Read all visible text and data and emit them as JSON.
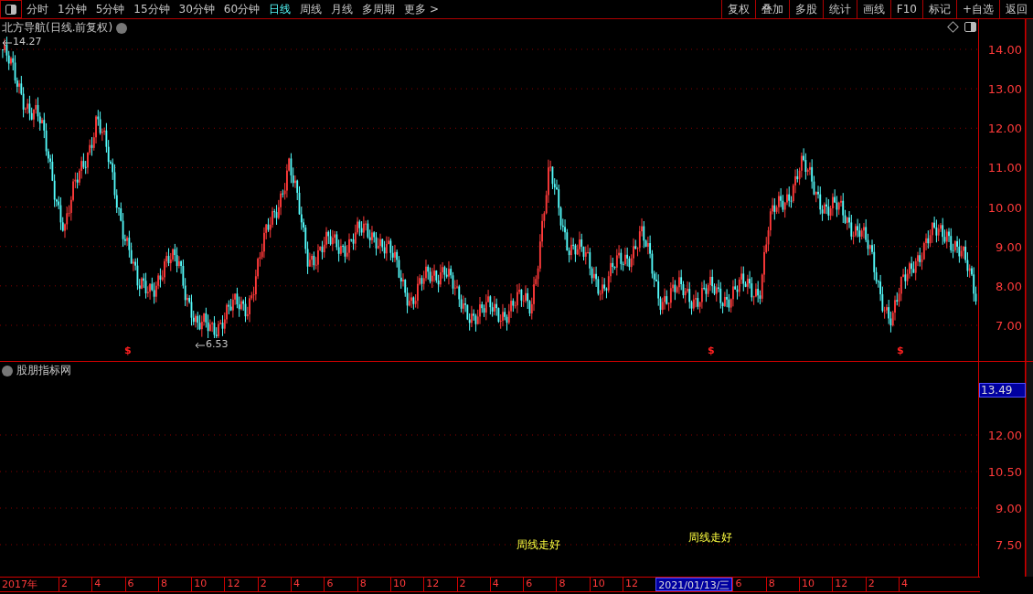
{
  "toolbar": {
    "periods": [
      {
        "label": "分时",
        "selected": false
      },
      {
        "label": "1分钟",
        "selected": false
      },
      {
        "label": "5分钟",
        "selected": false
      },
      {
        "label": "15分钟",
        "selected": false
      },
      {
        "label": "30分钟",
        "selected": false
      },
      {
        "label": "60分钟",
        "selected": false
      },
      {
        "label": "日线",
        "selected": true
      },
      {
        "label": "周线",
        "selected": false
      },
      {
        "label": "月线",
        "selected": false
      },
      {
        "label": "多周期",
        "selected": false
      },
      {
        "label": "更多 >",
        "selected": false
      }
    ],
    "actions": [
      "复权",
      "叠加",
      "多股",
      "统计",
      "画线",
      "F10",
      "标记",
      "+自选",
      "返回"
    ]
  },
  "main_chart": {
    "title": "北方导航(日线.前复权)",
    "high_label": "14.27",
    "low_label": "6.53",
    "signal_marks": [
      "$",
      "$",
      "$"
    ],
    "y_axis": [
      "14.00",
      "13.00",
      "12.00",
      "11.00",
      "10.00",
      "9.00",
      "8.00",
      "7.00"
    ]
  },
  "indicator_panel": {
    "title": "股朋指标网",
    "current_value": "13.49",
    "y_axis": [
      "12.00",
      "10.50",
      "9.00",
      "7.50"
    ],
    "annotations": [
      "周线走好",
      "周线走好"
    ]
  },
  "time_axis": {
    "labels": [
      {
        "text": "2017年",
        "selected": false
      },
      {
        "text": "2",
        "selected": false
      },
      {
        "text": "4",
        "selected": false
      },
      {
        "text": "6",
        "selected": false
      },
      {
        "text": "8",
        "selected": false
      },
      {
        "text": "10",
        "selected": false
      },
      {
        "text": "12",
        "selected": false
      },
      {
        "text": "2",
        "selected": false
      },
      {
        "text": "4",
        "selected": false
      },
      {
        "text": "6",
        "selected": false
      },
      {
        "text": "8",
        "selected": false
      },
      {
        "text": "10",
        "selected": false
      },
      {
        "text": "12",
        "selected": false
      },
      {
        "text": "2",
        "selected": false
      },
      {
        "text": "4",
        "selected": false
      },
      {
        "text": "6",
        "selected": false
      },
      {
        "text": "8",
        "selected": false
      },
      {
        "text": "10",
        "selected": false
      },
      {
        "text": "12",
        "selected": false
      },
      {
        "text": "2021/01/13/三",
        "selected": true
      },
      {
        "text": "6",
        "selected": false
      },
      {
        "text": "8",
        "selected": false
      },
      {
        "text": "10",
        "selected": false
      },
      {
        "text": "12",
        "selected": false
      },
      {
        "text": "2",
        "selected": false
      },
      {
        "text": "4",
        "selected": false
      }
    ]
  }
}
